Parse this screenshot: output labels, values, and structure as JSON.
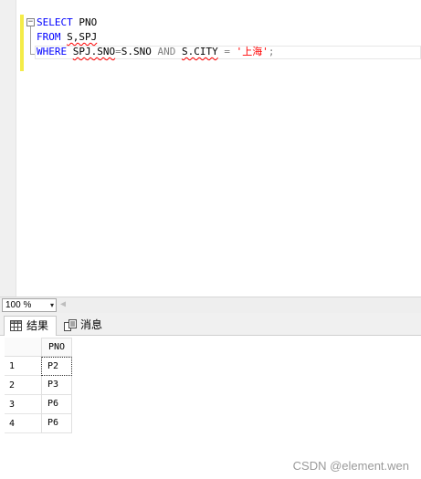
{
  "editor": {
    "fold_glyph": "−",
    "line1": {
      "kw": "SELECT",
      "rest": " PNO"
    },
    "line2": {
      "kw": "FROM",
      "rest_a": " ",
      "table": "S,SPJ"
    },
    "line3": {
      "kw": "WHERE",
      "sp1": " ",
      "spj_sno": "SPJ.SNO",
      "eq1": "=",
      "s_sno": "S.SNO",
      "sp2": " ",
      "and": "AND",
      "sp3": " ",
      "s_city": "S.CITY",
      "sp4": " ",
      "eq2": "=",
      "sp5": " ",
      "string": "'上海'",
      "semi": ";"
    }
  },
  "zoom": {
    "value": "100 %",
    "arrow": "▾",
    "scroll_left": "◀"
  },
  "tabs": [
    {
      "label": "结果",
      "icon": "grid-icon"
    },
    {
      "label": "消息",
      "icon": "messages-icon"
    }
  ],
  "grid": {
    "column": "PNO",
    "rows": [
      {
        "num": "1",
        "pno": "P2"
      },
      {
        "num": "2",
        "pno": "P3"
      },
      {
        "num": "3",
        "pno": "P6"
      },
      {
        "num": "4",
        "pno": "P6"
      }
    ]
  },
  "watermark": "CSDN @element.wen",
  "colors": {
    "keyword": "#0000ff",
    "string": "#ff0000",
    "operator": "#808080",
    "change_bar": "#f4ec48"
  }
}
